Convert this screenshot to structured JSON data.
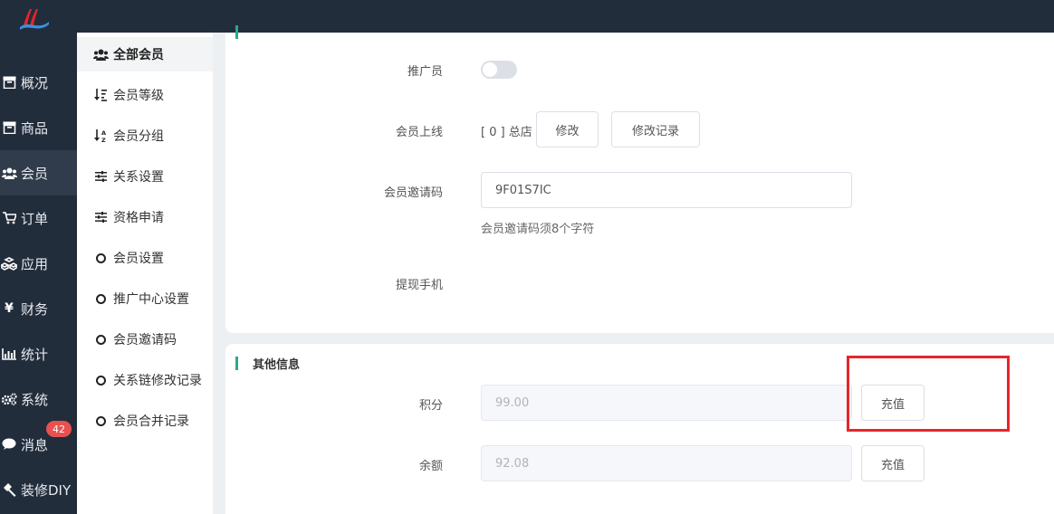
{
  "nav": {
    "items": [
      {
        "icon": "archive-icon",
        "label": "概况"
      },
      {
        "icon": "archive-icon",
        "label": "商品"
      },
      {
        "icon": "users-icon",
        "label": "会员"
      },
      {
        "icon": "cart-icon",
        "label": "订单"
      },
      {
        "icon": "cubes-icon",
        "label": "应用"
      },
      {
        "icon": "yen-icon",
        "label": "财务"
      },
      {
        "icon": "bar-chart-icon",
        "label": "统计"
      },
      {
        "icon": "gears-icon",
        "label": "系统"
      },
      {
        "icon": "comment-icon",
        "label": "消息"
      },
      {
        "icon": "hammer-icon",
        "label": "装修DIY"
      }
    ],
    "active_index": 2,
    "message_badge": "42"
  },
  "submenu": {
    "items": [
      {
        "icon": "users-icon",
        "label": "全部会员"
      },
      {
        "icon": "sort-amount-icon",
        "label": "会员等级"
      },
      {
        "icon": "sort-alpha-icon",
        "label": "会员分组"
      },
      {
        "icon": "sliders-icon",
        "label": "关系设置"
      },
      {
        "icon": "sliders-icon",
        "label": "资格申请"
      },
      {
        "icon": "circle-icon",
        "label": "会员设置"
      },
      {
        "icon": "circle-icon",
        "label": "推广中心设置"
      },
      {
        "icon": "circle-icon",
        "label": "会员邀请码"
      },
      {
        "icon": "circle-icon",
        "label": "关系链修改记录"
      },
      {
        "icon": "circle-icon",
        "label": "会员合并记录"
      }
    ],
    "active_index": 0
  },
  "form": {
    "promoter_label": "推广员",
    "promoter_on": false,
    "upline_label": "会员上线",
    "upline_value": "[ 0 ] 总店",
    "modify_button": "修改",
    "modify_record_button": "修改记录",
    "invite_code_label": "会员邀请码",
    "invite_code_value": "9F01S7IC",
    "invite_code_hint": "会员邀请码须8个字符",
    "withdraw_phone_label": "提现手机"
  },
  "other_info": {
    "title": "其他信息",
    "points_label": "积分",
    "points_value": "99.00",
    "balance_label": "余额",
    "balance_value": "92.08",
    "recharge_button": "充值"
  },
  "colors": {
    "topbar": "#222d3c",
    "accent": "#2aa98b",
    "badge": "#e9504f",
    "highlight_box": "#e5262b"
  }
}
